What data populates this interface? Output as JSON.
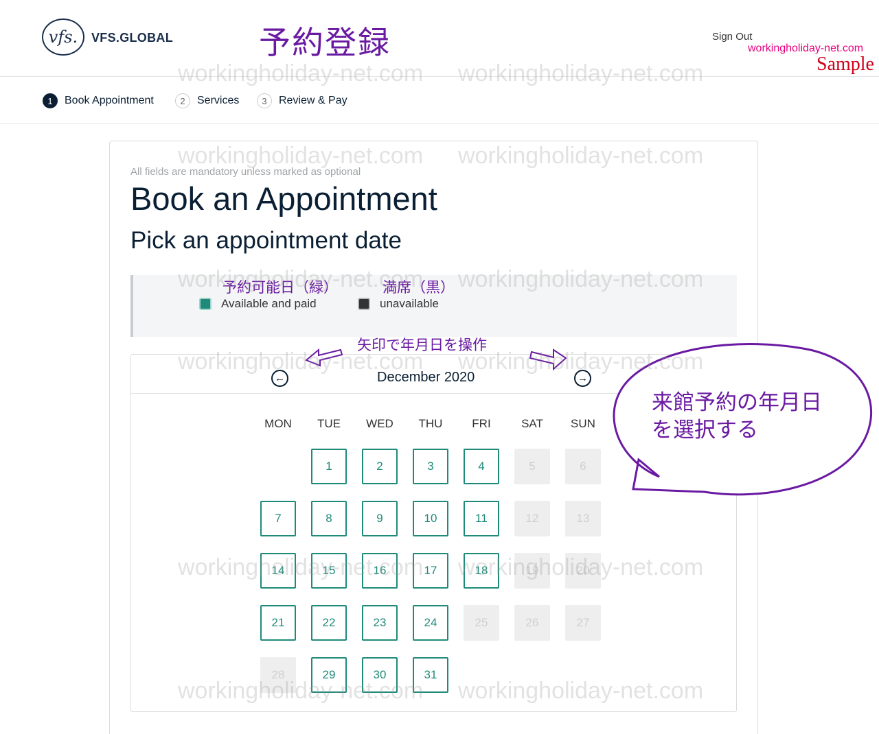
{
  "header": {
    "logo_text": "vfs.",
    "brand": "VFS.GLOBAL",
    "jp_title": "予約登録",
    "sign_out": "Sign Out",
    "site_url": "workingholiday-net.com",
    "sample": "Sample"
  },
  "steps": [
    {
      "num": "1",
      "label": "Book Appointment"
    },
    {
      "num": "2",
      "label": "Services"
    },
    {
      "num": "3",
      "label": "Review & Pay"
    }
  ],
  "form": {
    "mandatory_note": "All fields are mandatory unless marked as optional",
    "title": "Book an Appointment",
    "subtitle": "Pick an appointment date"
  },
  "legend": {
    "available_jp": "予約可能日（緑）",
    "available": "Available and paid",
    "unavailable_jp": "満席（黒）",
    "unavailable": "unavailable",
    "arrow_note": "矢印で年月日を操作"
  },
  "calendar": {
    "month": "December 2020",
    "prev_icon": "←",
    "next_icon": "→",
    "weekdays": [
      "MON",
      "TUE",
      "WED",
      "THU",
      "FRI",
      "SAT",
      "SUN"
    ],
    "first_col": 1,
    "available": [
      1,
      2,
      3,
      4,
      7,
      8,
      9,
      10,
      11,
      14,
      15,
      16,
      17,
      18,
      21,
      22,
      23,
      24,
      29,
      30,
      31
    ],
    "unavailable": [
      5,
      6,
      12,
      13,
      19,
      20,
      25,
      26,
      27,
      28
    ],
    "days_in_month": 31
  },
  "bubble": {
    "line1": "来館予約の年月日",
    "line2": "を選択する"
  },
  "watermark": "workingholiday-net.com",
  "colors": {
    "available": "#1f8a7a",
    "unavailable": "#eeeeee",
    "annotation": "#6a1aa2",
    "navy": "#0a1f33"
  }
}
